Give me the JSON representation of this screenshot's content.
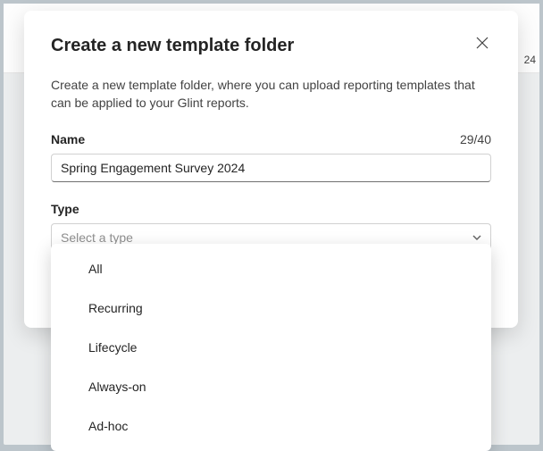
{
  "backdrop": {
    "peek": "24"
  },
  "modal": {
    "title": "Create a new template folder",
    "description": "Create a new template folder, where you can upload reporting templates that can be applied to your Glint reports.",
    "name_field": {
      "label": "Name",
      "value": "Spring Engagement Survey 2024",
      "char_count": "29/40"
    },
    "type_field": {
      "label": "Type",
      "placeholder": "Select a type"
    }
  },
  "dropdown": {
    "options": [
      "All",
      "Recurring",
      "Lifecycle",
      "Always-on",
      "Ad-hoc"
    ]
  }
}
